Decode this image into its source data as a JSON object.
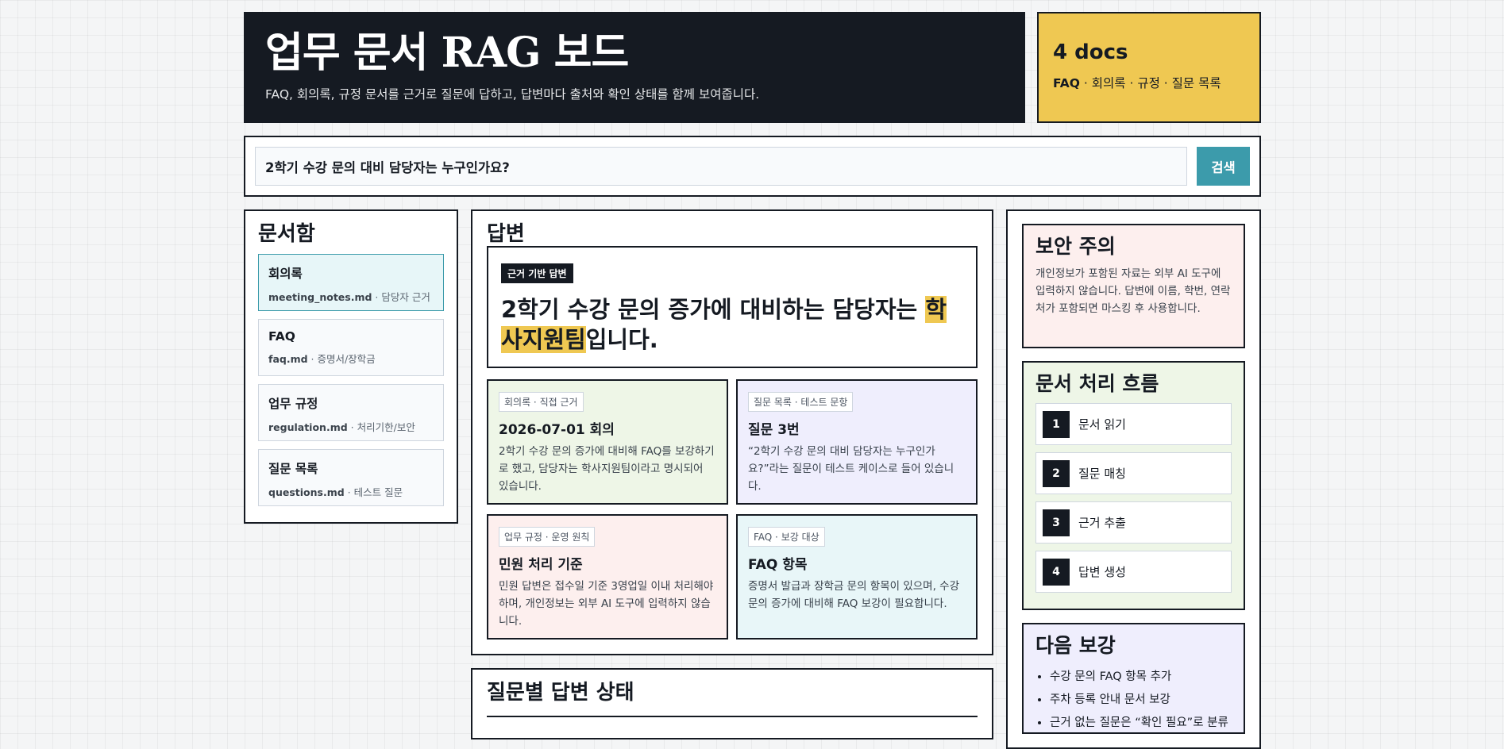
{
  "header": {
    "title": "업무 문서 RAG 보드",
    "subtitle": "FAQ, 회의록, 규정 문서를 근거로 질문에 답하고, 답변마다 출처와 확인 상태를 함께 보여줍니다."
  },
  "docs_summary": {
    "count": "4 docs",
    "lead": "FAQ",
    "rest": " · 회의록 · 규정 · 질문 목록"
  },
  "search": {
    "value": "2학기 수강 문의 대비 담당자는 누구인가요?",
    "button_label": "검색"
  },
  "docbox": {
    "heading": "문서함",
    "items": [
      {
        "title": "회의록",
        "file": "meeting_notes.md",
        "desc": " · 담당자 근거"
      },
      {
        "title": "FAQ",
        "file": "faq.md",
        "desc": " · 증명서/장학금"
      },
      {
        "title": "업무 규정",
        "file": "regulation.md",
        "desc": " · 처리기한/보안"
      },
      {
        "title": "질문 목록",
        "file": "questions.md",
        "desc": " · 테스트 질문"
      }
    ]
  },
  "answer": {
    "heading": "답변",
    "badge": "근거 기반 답변",
    "text_before": "2학기 수강 문의 증가에 대비하는 담당자는 ",
    "highlight": "학사지원팀",
    "text_after": "입니다.",
    "cards": [
      {
        "tag": "회의록 · 직접 근거",
        "title": "2026-07-01 회의",
        "body": "2학기 수강 문의 증가에 대비해 FAQ를 보강하기로 했고, 담당자는 학사지원팀이라고 명시되어 있습니다."
      },
      {
        "tag": "질문 목록 · 테스트 문항",
        "title": "질문 3번",
        "body": "“2학기 수강 문의 대비 담당자는 누구인가요?”라는 질문이 테스트 케이스로 들어 있습니다."
      },
      {
        "tag": "업무 규정 · 운영 원칙",
        "title": "민원 처리 기준",
        "body": "민원 답변은 접수일 기준 3영업일 이내 처리해야 하며, 개인정보는 외부 AI 도구에 입력하지 않습니다."
      },
      {
        "tag": "FAQ · 보강 대상",
        "title": "FAQ 항목",
        "body": "증명서 발급과 장학금 문의 항목이 있으며, 수강 문의 증가에 대비해 FAQ 보강이 필요합니다."
      }
    ]
  },
  "status": {
    "heading": "질문별 답변 상태"
  },
  "security": {
    "heading": "보안 주의",
    "body": "개인정보가 포함된 자료는 외부 AI 도구에 입력하지 않습니다. 답변에 이름, 학번, 연락처가 포함되면 마스킹 후 사용합니다."
  },
  "flow": {
    "heading": "문서 처리 흐름",
    "steps": [
      {
        "num": "1",
        "label": "문서 읽기"
      },
      {
        "num": "2",
        "label": "질문 매칭"
      },
      {
        "num": "3",
        "label": "근거 추출"
      },
      {
        "num": "4",
        "label": "답변 생성"
      }
    ]
  },
  "next": {
    "heading": "다음 보강",
    "items": [
      "수강 문의 FAQ 항목 추가",
      "주차 등록 안내 문서 보강",
      "근거 없는 질문은 “확인 필요”로 분류"
    ]
  }
}
